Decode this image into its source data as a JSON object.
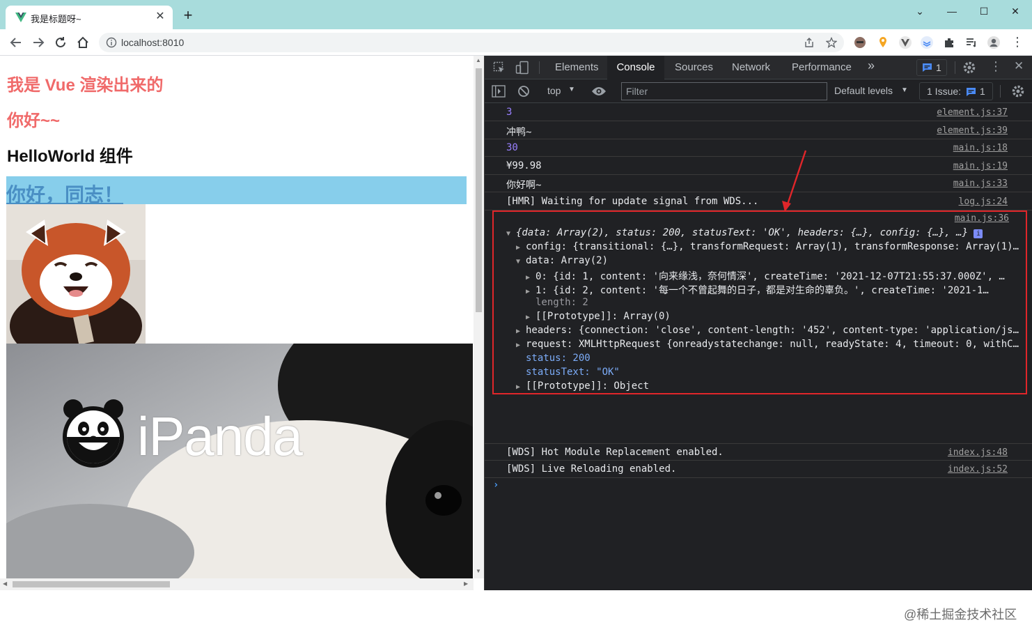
{
  "browser": {
    "tab_title": "我是标题呀~",
    "url": "localhost:8010"
  },
  "page": {
    "heading_vue": "我是 Vue 渲染出来的",
    "heading_hello": "你好~~",
    "heading_component": "HelloWorld 组件",
    "banner_link": "你好，同志！",
    "ipanda_logo_text": "iPanda"
  },
  "devtools": {
    "tabs": [
      "Elements",
      "Console",
      "Sources",
      "Network",
      "Performance"
    ],
    "more_tabs": "»",
    "issues_badge_count": "1",
    "context": "top",
    "filter_placeholder": "Filter",
    "levels": "Default levels",
    "issues_label": "1 Issue:",
    "issues_count": "1"
  },
  "console": {
    "rows": [
      {
        "text": "3",
        "source": "element.js:37"
      },
      {
        "text": "冲鸭~",
        "source": "element.js:39"
      },
      {
        "text": "30",
        "source": "main.js:18"
      },
      {
        "text": "¥99.98",
        "source": "main.js:19"
      },
      {
        "text": "你好啊~",
        "source": "main.js:33"
      },
      {
        "text": "[HMR] Waiting for update signal from WDS...",
        "source": "log.js:24"
      }
    ],
    "object_source": "main.js:36",
    "object": {
      "summary": "{data: Array(2), status: 200, statusText: 'OK', headers: {…}, config: {…}, …}",
      "config": "config: {transitional: {…}, transformRequest: Array(1), transformResponse: Array(1)…",
      "data": "data: Array(2)",
      "item0": "0: {id: 1, content: '向来缘浅，奈何情深', createTime: '2021-12-07T21:55:37.000Z', …",
      "item1": "1: {id: 2, content: '每一个不曾起舞的日子，都是对生命的辜负。', createTime: '2021-1…",
      "length": "length: 2",
      "proto_array": "[[Prototype]]: Array(0)",
      "headers": "headers: {connection: 'close', content-length: '452', content-type: 'application/js…",
      "request": "request: XMLHttpRequest {onreadystatechange: null, readyState: 4, timeout: 0, withC…",
      "status": "status: 200",
      "status_text": "statusText: \"OK\"",
      "proto_object": "[[Prototype]]: Object"
    },
    "after_rows": [
      {
        "text": "[WDS] Hot Module Replacement enabled.",
        "source": "index.js:48"
      },
      {
        "text": "[WDS] Live Reloading enabled.",
        "source": "index.js:52"
      }
    ],
    "prompt": "›"
  },
  "watermark": "@稀土掘金技术社区",
  "colors": {
    "tab_strip": "#a8dcdc",
    "heading_red": "#f06a6a",
    "banner_bg": "#87ceeb",
    "devtools_bg": "#202124",
    "highlight_box": "#e0262a"
  }
}
